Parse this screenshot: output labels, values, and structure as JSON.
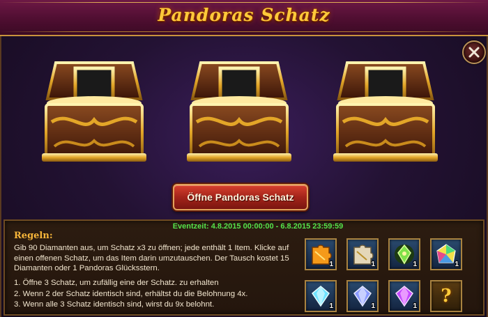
{
  "window": {
    "title": "Pandoras Schatz"
  },
  "icons": {
    "close": "close-icon",
    "chest": "treasure-chest-icon",
    "unknown": "question-mark-icon"
  },
  "colors": {
    "title": "#ffc93a",
    "event_time": "#54e24a",
    "rules_heading": "#f6b53a",
    "button": "#a3241a"
  },
  "chests": [
    {
      "name": "chest-1"
    },
    {
      "name": "chest-2"
    },
    {
      "name": "chest-3"
    }
  ],
  "open_button": {
    "label": "Öffne Pandoras Schatz"
  },
  "event": {
    "label": "Eventzeit: 4.8.2015 00:00:00 - 6.8.2015 23:59:59"
  },
  "rules": {
    "heading": "Regeln:",
    "paragraph": "Gib 90 Diamanten aus, um Schatz x3 zu öffnen; jede enthält 1 Item. Klicke auf einen offenen Schatz, um das Item darin umzutauschen. Der Tausch kostet 15 Diamanten oder 1 Pandoras Glücksstern.",
    "items": [
      "1. Öffne 3  Schatz, um zufällig eine der Schatz. zu erhalten",
      "2. Wenn 2 der Schatz identisch sind, erhältst du die Belohnung 4x.",
      "3. Wenn alle 3 Schatz identisch sind, wirst du 9x belohnt."
    ]
  },
  "rewards": [
    {
      "name": "orange-puzzle-piece",
      "qty": "1"
    },
    {
      "name": "silver-puzzle-piece",
      "qty": "1"
    },
    {
      "name": "green-crystal-item",
      "qty": "1"
    },
    {
      "name": "rainbow-gem",
      "qty": "1"
    },
    {
      "name": "blue-diamond",
      "qty": "1"
    },
    {
      "name": "purple-blue-diamond",
      "qty": "1"
    },
    {
      "name": "violet-diamond",
      "qty": "1"
    },
    {
      "name": "unknown-reward",
      "qty": "?"
    }
  ]
}
